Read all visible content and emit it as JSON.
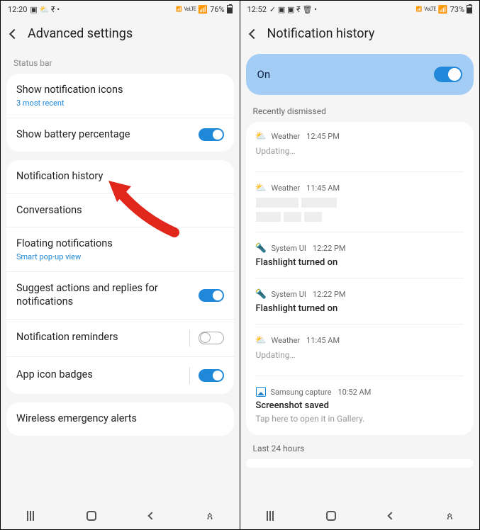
{
  "left": {
    "status": {
      "time": "12:20",
      "battery": "76%"
    },
    "header": {
      "title": "Advanced settings"
    },
    "section1_label": "Status bar",
    "rows1": [
      {
        "title": "Show notification icons",
        "sub": "3 most recent"
      },
      {
        "title": "Show battery percentage",
        "toggle": "on"
      }
    ],
    "rows2": [
      {
        "title": "Notification history"
      },
      {
        "title": "Conversations"
      },
      {
        "title": "Floating notifications",
        "sub": "Smart pop-up view"
      },
      {
        "title": "Suggest actions and replies for notifications",
        "toggle": "on"
      },
      {
        "title": "Notification reminders",
        "toggle": "off",
        "sep": true
      },
      {
        "title": "App icon badges",
        "toggle": "on",
        "sep": true
      }
    ],
    "rows3": [
      {
        "title": "Wireless emergency alerts"
      }
    ]
  },
  "right": {
    "status": {
      "time": "12:52",
      "battery": "73%"
    },
    "header": {
      "title": "Notification history"
    },
    "on_label": "On",
    "recent_label": "Recently dismissed",
    "notifs": [
      {
        "icon": "weather",
        "app": "Weather",
        "time": "12:45 PM",
        "title": "",
        "sub": "Updating…",
        "subgrey": true
      },
      {
        "icon": "weather",
        "app": "Weather",
        "time": "11:45 AM",
        "redacted": true
      },
      {
        "icon": "flash",
        "app": "System UI",
        "time": "12:22 PM",
        "title": "Flashlight turned on"
      },
      {
        "icon": "flash",
        "app": "System UI",
        "time": "12:22 PM",
        "title": "Flashlight turned on"
      },
      {
        "icon": "weather",
        "app": "Weather",
        "time": "11:45 AM",
        "title": "",
        "sub": "Updating…",
        "subgrey": true
      },
      {
        "icon": "capture",
        "app": "Samsung capture",
        "time": "10:52 AM",
        "title": "Screenshot saved",
        "sub": "Tap here to open it in Gallery."
      }
    ],
    "last24": "Last 24 hours"
  }
}
